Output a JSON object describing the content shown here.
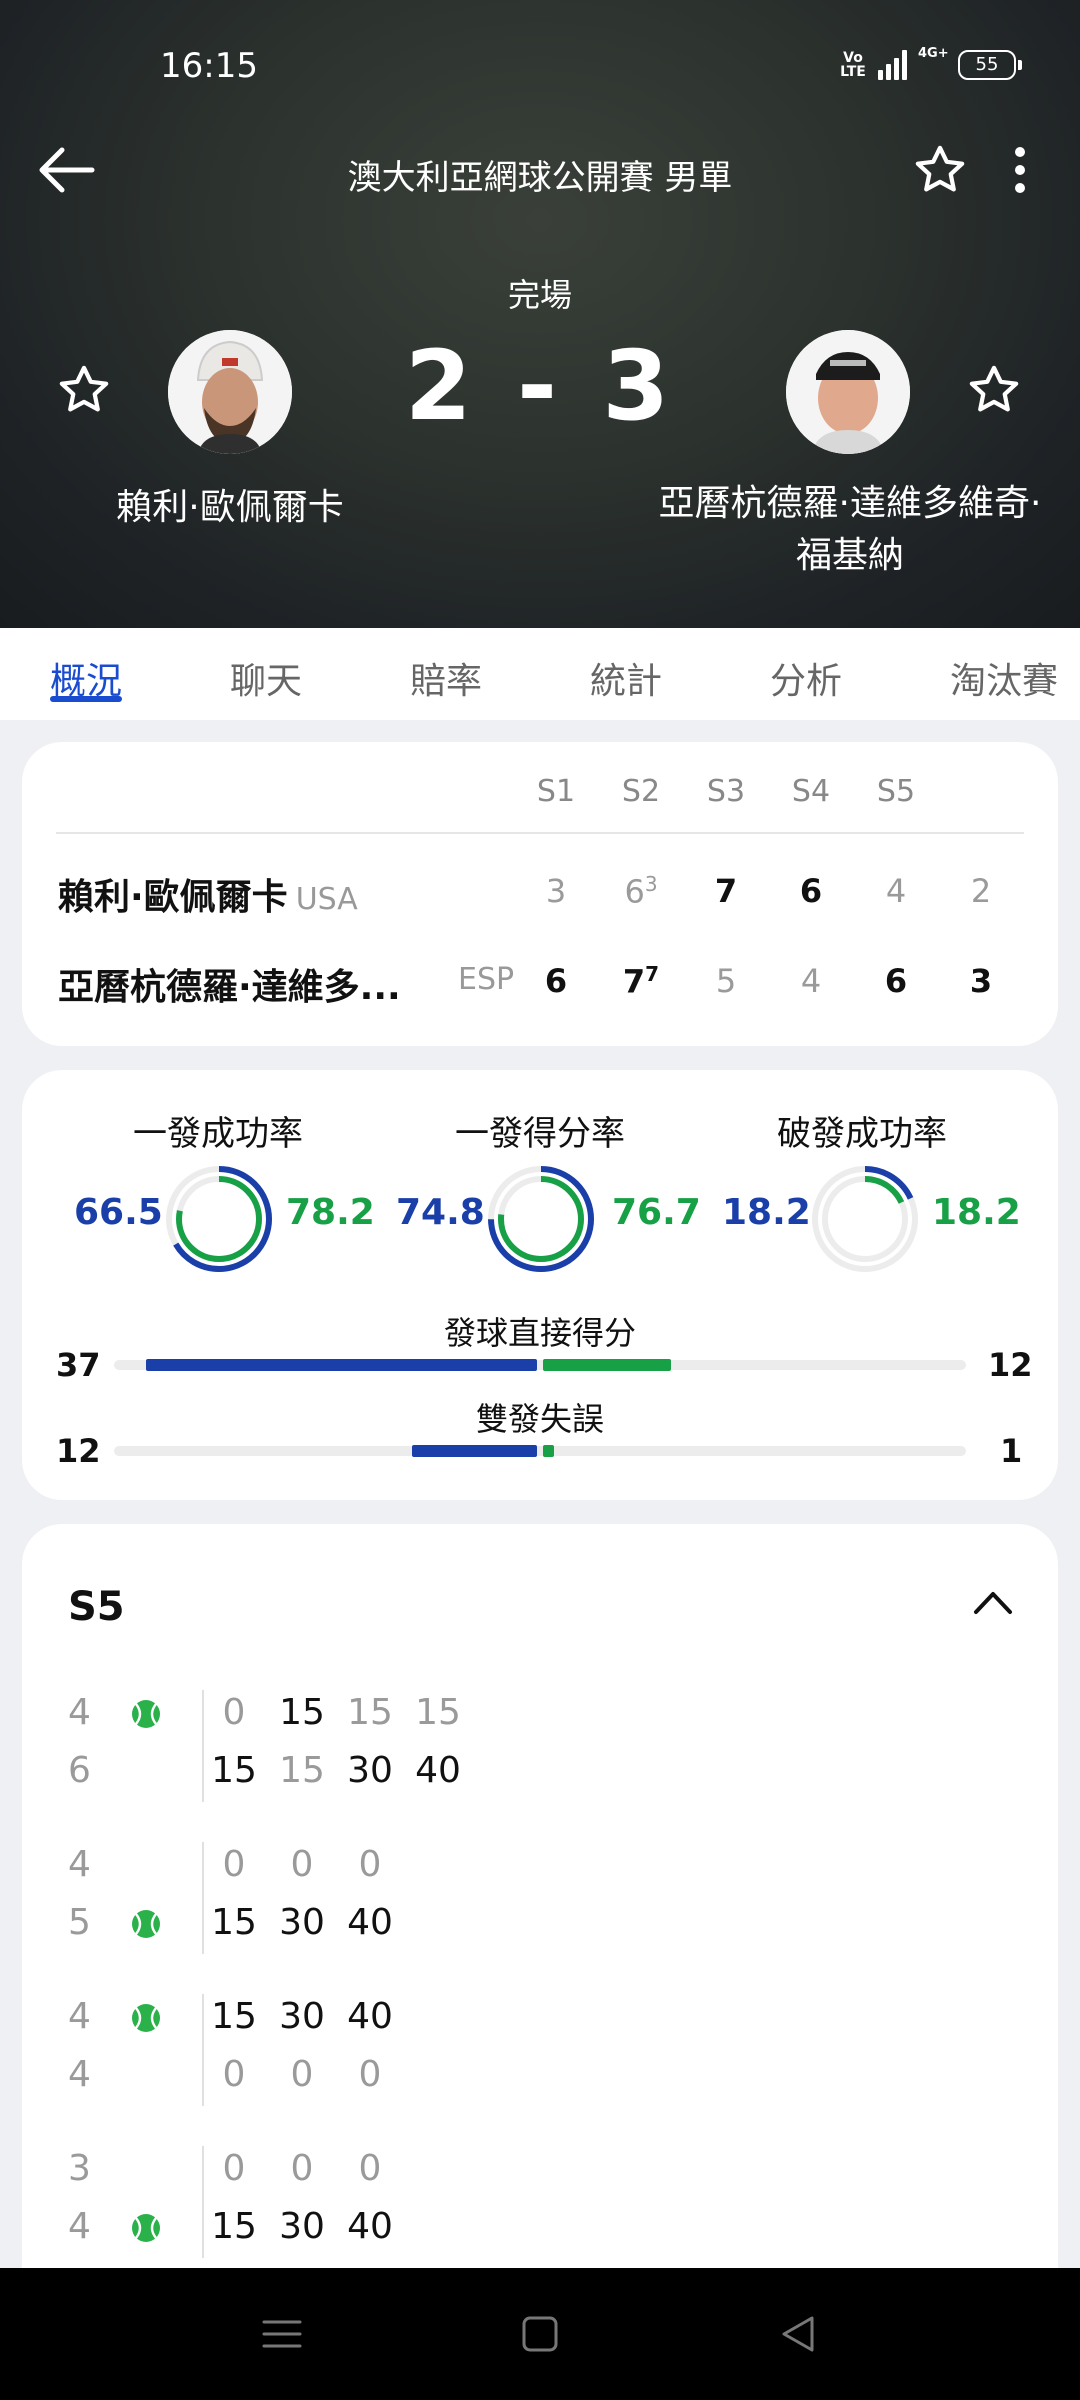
{
  "status_bar": {
    "time": "16:15",
    "volte": "Vo LTE",
    "network": "4G+",
    "battery": "55"
  },
  "header": {
    "title": "澳大利亞網球公開賽 男單",
    "match_status": "完場",
    "score": "2 - 3",
    "player1": {
      "name": "賴利·歐佩爾卡"
    },
    "player2": {
      "name_line1": "亞曆杭德羅·達維多維奇·",
      "name_line2": "福基納"
    }
  },
  "tabs": [
    {
      "label": "概況",
      "active": true
    },
    {
      "label": "聊天"
    },
    {
      "label": "賠率"
    },
    {
      "label": "統計"
    },
    {
      "label": "分析"
    },
    {
      "label": "淘汰賽"
    }
  ],
  "scoreboard": {
    "headers": [
      "S1",
      "S2",
      "S3",
      "S4",
      "S5"
    ],
    "rows": [
      {
        "name": "賴利·歐佩爾卡",
        "country": "USA",
        "sets": [
          {
            "v": "3",
            "w": false
          },
          {
            "v": "6",
            "tb": "3",
            "w": false
          },
          {
            "v": "7",
            "w": true
          },
          {
            "v": "6",
            "w": true
          },
          {
            "v": "4",
            "w": false
          }
        ],
        "current": "2",
        "current_w": false
      },
      {
        "name": "亞曆杭德羅·達維多...",
        "country": "ESP",
        "sets": [
          {
            "v": "6",
            "w": true
          },
          {
            "v": "7",
            "tb": "7",
            "w": true
          },
          {
            "v": "5",
            "w": false
          },
          {
            "v": "4",
            "w": false
          },
          {
            "v": "6",
            "w": true
          }
        ],
        "current": "3",
        "current_w": true
      }
    ]
  },
  "stats": {
    "circles": [
      {
        "label": "一發成功率",
        "left": "66.5",
        "right": "78.2",
        "left_pct": 66.5,
        "right_pct": 78.2
      },
      {
        "label": "一發得分率",
        "left": "74.8",
        "right": "76.7",
        "left_pct": 74.8,
        "right_pct": 76.7
      },
      {
        "label": "破發成功率",
        "left": "18.2",
        "right": "18.2",
        "left_pct": 18.2,
        "right_pct": 18.2
      }
    ],
    "bars": [
      {
        "label": "發球直接得分",
        "left": "37",
        "right": "12",
        "left_n": 37,
        "right_n": 12
      },
      {
        "label": "雙發失誤",
        "left": "12",
        "right": "1",
        "left_n": 12,
        "right_n": 1
      }
    ]
  },
  "set_detail": {
    "title": "S5",
    "games": [
      {
        "top": {
          "g": "4",
          "serve": true,
          "pts": [
            "0",
            "15",
            "15",
            "15"
          ],
          "on": [
            false,
            true,
            false,
            false
          ]
        },
        "bot": {
          "g": "6",
          "serve": false,
          "pts": [
            "15",
            "15",
            "30",
            "40"
          ],
          "on": [
            true,
            false,
            true,
            true
          ]
        }
      },
      {
        "top": {
          "g": "4",
          "serve": false,
          "pts": [
            "0",
            "0",
            "0"
          ],
          "on": [
            false,
            false,
            false
          ]
        },
        "bot": {
          "g": "5",
          "serve": true,
          "pts": [
            "15",
            "30",
            "40"
          ],
          "on": [
            true,
            true,
            true
          ]
        }
      },
      {
        "top": {
          "g": "4",
          "serve": true,
          "pts": [
            "15",
            "30",
            "40"
          ],
          "on": [
            true,
            true,
            true
          ]
        },
        "bot": {
          "g": "4",
          "serve": false,
          "pts": [
            "0",
            "0",
            "0"
          ],
          "on": [
            false,
            false,
            false
          ]
        }
      },
      {
        "top": {
          "g": "3",
          "serve": false,
          "pts": [
            "0",
            "0",
            "0"
          ],
          "on": [
            false,
            false,
            false
          ]
        },
        "bot": {
          "g": "4",
          "serve": true,
          "pts": [
            "15",
            "30",
            "40"
          ],
          "on": [
            true,
            true,
            true
          ]
        }
      }
    ]
  },
  "colors": {
    "accent_blue": "#1a3fa8",
    "accent_green": "#17a046",
    "tab_active": "#1a4cd0"
  }
}
